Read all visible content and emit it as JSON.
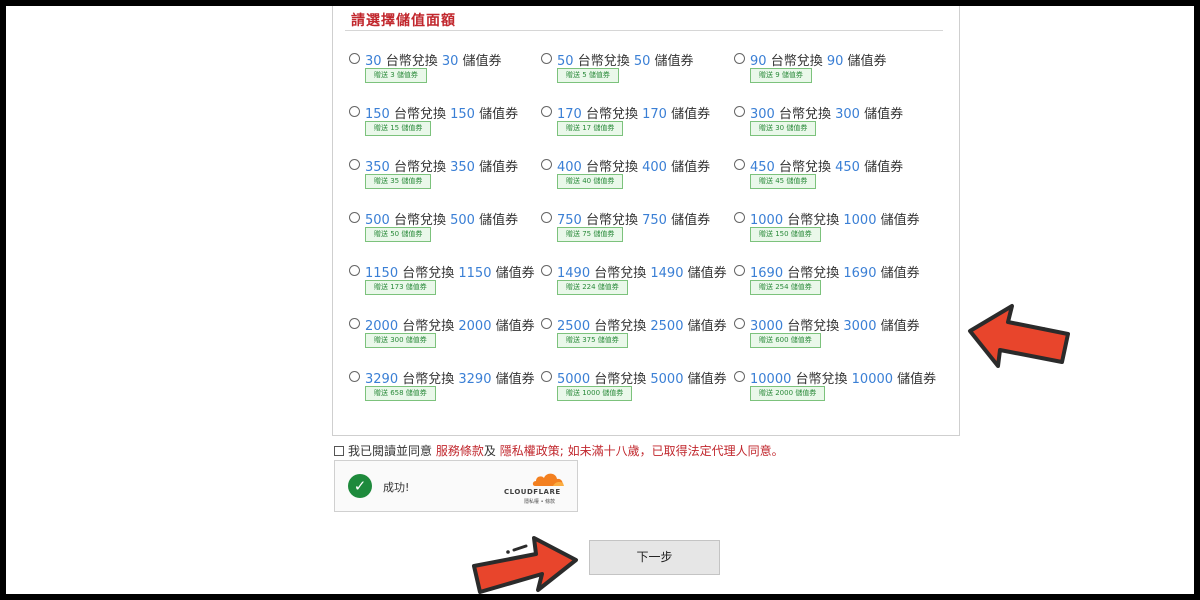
{
  "form": {
    "section_title": "請選擇儲值面額",
    "options": [
      {
        "amount": "30",
        "currency_text": "台幣兌換",
        "value": "30",
        "unit": "儲值券",
        "bonus": "贈送 3 儲值券"
      },
      {
        "amount": "50",
        "currency_text": "台幣兌換",
        "value": "50",
        "unit": "儲值券",
        "bonus": "贈送 5 儲值券"
      },
      {
        "amount": "90",
        "currency_text": "台幣兌換",
        "value": "90",
        "unit": "儲值券",
        "bonus": "贈送 9 儲值券"
      },
      {
        "amount": "150",
        "currency_text": "台幣兌換",
        "value": "150",
        "unit": "儲值券",
        "bonus": "贈送 15 儲值券"
      },
      {
        "amount": "170",
        "currency_text": "台幣兌換",
        "value": "170",
        "unit": "儲值券",
        "bonus": "贈送 17 儲值券"
      },
      {
        "amount": "300",
        "currency_text": "台幣兌換",
        "value": "300",
        "unit": "儲值券",
        "bonus": "贈送 30 儲值券"
      },
      {
        "amount": "350",
        "currency_text": "台幣兌換",
        "value": "350",
        "unit": "儲值券",
        "bonus": "贈送 35 儲值券"
      },
      {
        "amount": "400",
        "currency_text": "台幣兌換",
        "value": "400",
        "unit": "儲值券",
        "bonus": "贈送 40 儲值券"
      },
      {
        "amount": "450",
        "currency_text": "台幣兌換",
        "value": "450",
        "unit": "儲值券",
        "bonus": "贈送 45 儲值券"
      },
      {
        "amount": "500",
        "currency_text": "台幣兌換",
        "value": "500",
        "unit": "儲值券",
        "bonus": "贈送 50 儲值券"
      },
      {
        "amount": "750",
        "currency_text": "台幣兌換",
        "value": "750",
        "unit": "儲值券",
        "bonus": "贈送 75 儲值券"
      },
      {
        "amount": "1000",
        "currency_text": "台幣兌換",
        "value": "1000",
        "unit": "儲值券",
        "bonus": "贈送 150 儲值券"
      },
      {
        "amount": "1150",
        "currency_text": "台幣兌換",
        "value": "1150",
        "unit": "儲值券",
        "bonus": "贈送 173 儲值券"
      },
      {
        "amount": "1490",
        "currency_text": "台幣兌換",
        "value": "1490",
        "unit": "儲值券",
        "bonus": "贈送 224 儲值券"
      },
      {
        "amount": "1690",
        "currency_text": "台幣兌換",
        "value": "1690",
        "unit": "儲值券",
        "bonus": "贈送 254 儲值券"
      },
      {
        "amount": "2000",
        "currency_text": "台幣兌換",
        "value": "2000",
        "unit": "儲值券",
        "bonus": "贈送 300 儲值券"
      },
      {
        "amount": "2500",
        "currency_text": "台幣兌換",
        "value": "2500",
        "unit": "儲值券",
        "bonus": "贈送 375 儲值券"
      },
      {
        "amount": "3000",
        "currency_text": "台幣兌換",
        "value": "3000",
        "unit": "儲值券",
        "bonus": "贈送 600 儲值券"
      },
      {
        "amount": "3290",
        "currency_text": "台幣兌換",
        "value": "3290",
        "unit": "儲值券",
        "bonus": "贈送 658 儲值券"
      },
      {
        "amount": "5000",
        "currency_text": "台幣兌換",
        "value": "5000",
        "unit": "儲值券",
        "bonus": "贈送 1000 儲值券"
      },
      {
        "amount": "10000",
        "currency_text": "台幣兌換",
        "value": "10000",
        "unit": "儲值券",
        "bonus": "贈送 2000 儲值券"
      }
    ]
  },
  "agreement": {
    "prefix": "我已閱讀並同意",
    "terms_link": "服務條款",
    "and": "及",
    "privacy_link": "隱私權政策;",
    "minor_note": "如未滿十八歲，已取得法定代理人同意。"
  },
  "captcha": {
    "status": "成功!",
    "brand": "CLOUDFLARE",
    "privacy": "隱私權",
    "separator": "•",
    "terms": "條款",
    "check_icon": "checkmark-icon",
    "logo_icon": "cloud-icon"
  },
  "next_button": {
    "label": "下一步"
  },
  "colors": {
    "accent_red": "#c1272d",
    "number_blue": "#3a7fd5",
    "bonus_green": "#2a8a3a",
    "arrow_orange": "#e8452c"
  }
}
